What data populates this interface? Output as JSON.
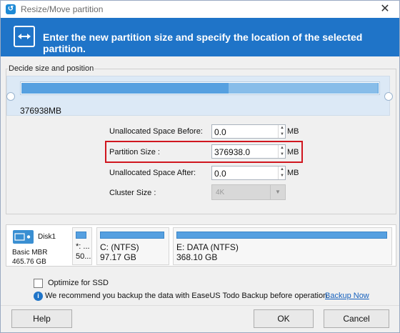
{
  "window": {
    "title": "Resize/Move partition",
    "app_icon": "easeus-icon",
    "close_glyph": "✕"
  },
  "banner": {
    "text": "Enter the new partition size and specify the location of the selected partition."
  },
  "group": {
    "label": "Decide size and position"
  },
  "bar": {
    "size_label": "376938MB"
  },
  "fields": {
    "before": {
      "label": "Unallocated Space Before:",
      "value": "0.0",
      "unit": "MB"
    },
    "size": {
      "label": "Partition Size :",
      "value": "376938.0",
      "unit": "MB"
    },
    "after": {
      "label": "Unallocated Space After:",
      "value": "0.0",
      "unit": "MB"
    },
    "cluster": {
      "label": "Cluster Size :",
      "value": "4K"
    }
  },
  "disk": {
    "name": "Disk1",
    "type": "Basic MBR",
    "size": "465.76 GB",
    "partitions": [
      {
        "name": "*: ...",
        "size": "50..."
      },
      {
        "name": "C: (NTFS)",
        "size": "97.17 GB"
      },
      {
        "name": "E: DATA (NTFS)",
        "size": "368.10 GB"
      }
    ]
  },
  "options": {
    "optimize_ssd_label": "Optimize for SSD",
    "optimize_ssd_checked": false
  },
  "info": {
    "text": "We recommend you backup the data with EaseUS Todo Backup before operation.",
    "link": "Backup Now"
  },
  "buttons": {
    "help": "Help",
    "ok": "OK",
    "cancel": "Cancel"
  },
  "colors": {
    "banner": "#1f74c8",
    "bar": "#56a0e0",
    "highlight": "#d0161f"
  }
}
